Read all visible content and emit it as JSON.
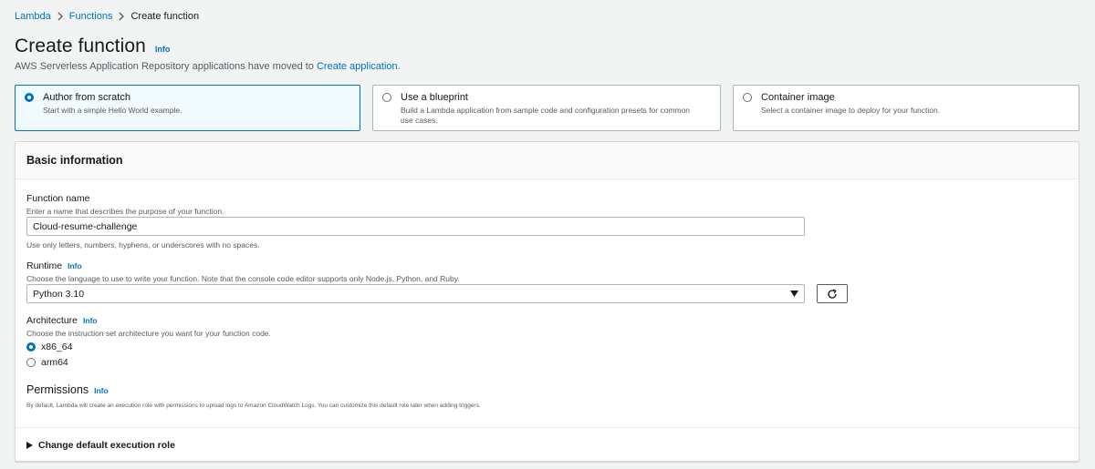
{
  "breadcrumb": {
    "items": [
      {
        "label": "Lambda"
      },
      {
        "label": "Functions"
      },
      {
        "label": "Create function"
      }
    ]
  },
  "header": {
    "title": "Create function",
    "info_label": "Info",
    "subtitle_prefix": "AWS Serverless Application Repository applications have moved to ",
    "subtitle_link": "Create application",
    "subtitle_suffix": "."
  },
  "options": [
    {
      "title": "Author from scratch",
      "description": "Start with a simple Hello World example.",
      "selected": true
    },
    {
      "title": "Use a blueprint",
      "description": "Build a Lambda application from sample code and configuration presets for common use cases.",
      "selected": false
    },
    {
      "title": "Container image",
      "description": "Select a container image to deploy for your function.",
      "selected": false
    }
  ],
  "basic_info": {
    "title": "Basic information",
    "function_name": {
      "label": "Function name",
      "description": "Enter a name that describes the purpose of your function.",
      "value": "Cloud-resume-challenge",
      "constraint": "Use only letters, numbers, hyphens, or underscores with no spaces."
    },
    "runtime": {
      "label": "Runtime",
      "info_label": "Info",
      "description": "Choose the language to use to write your function. Note that the console code editor supports only Node.js, Python, and Ruby.",
      "value": "Python 3.10"
    },
    "architecture": {
      "label": "Architecture",
      "info_label": "Info",
      "description": "Choose the instruction set architecture you want for your function code.",
      "options": [
        {
          "label": "x86_64",
          "selected": true
        },
        {
          "label": "arm64",
          "selected": false
        }
      ]
    },
    "permissions": {
      "title": "Permissions",
      "info_label": "Info",
      "description": "By default, Lambda will create an execution role with permissions to upload logs to Amazon CloudWatch Logs. You can customize this default role later when adding triggers."
    },
    "expander_label": "Change default execution role"
  },
  "colors": {
    "accent": "#0073bb",
    "selected_tile_bg": "#f1faff",
    "page_bg": "#f2f3f3"
  }
}
